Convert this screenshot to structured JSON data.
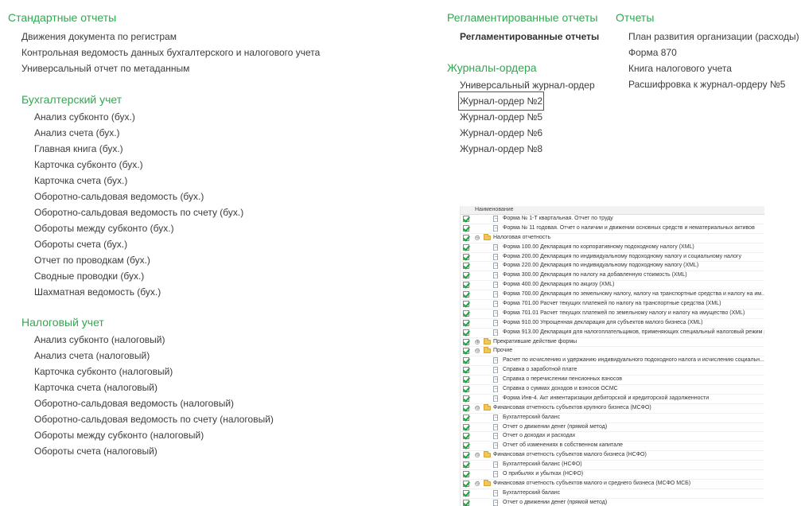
{
  "standard": {
    "title": "Стандартные отчеты",
    "items": [
      "Движения документа по регистрам",
      "Контрольная ведомость данных бухгалтерского и налогового учета",
      "Универсальный отчет по метаданным"
    ]
  },
  "accounting": {
    "title": "Бухгалтерский учет",
    "items": [
      "Анализ субконто (бух.)",
      "Анализ счета (бух.)",
      "Главная книга (бух.)",
      "Карточка субконто (бух.)",
      "Карточка счета (бух.)",
      "Оборотно-сальдовая ведомость (бух.)",
      "Оборотно-сальдовая ведомость по счету (бух.)",
      "Обороты между субконто (бух.)",
      "Обороты счета (бух.)",
      "Отчет по проводкам (бух.)",
      "Сводные проводки (бух.)",
      "Шахматная ведомость (бух.)"
    ]
  },
  "tax": {
    "title": "Налоговый учет",
    "items": [
      "Анализ субконто (налоговый)",
      "Анализ счета (налоговый)",
      "Карточка субконто (налоговый)",
      "Карточка счета (налоговый)",
      "Оборотно-сальдовая ведомость (налоговый)",
      "Оборотно-сальдовая ведомость по счету (налоговый)",
      "Обороты между субконто (налоговый)",
      "Обороты счета (налоговый)"
    ]
  },
  "regulated": {
    "title": "Регламентированные отчеты",
    "items": [
      "Регламентированные отчеты"
    ]
  },
  "journals": {
    "title": "Журналы-ордера",
    "items": [
      "Универсальный журнал-ордер",
      "Журнал-ордер №2",
      "Журнал-ордер №5",
      "Журнал-ордер №6",
      "Журнал-ордер №8"
    ]
  },
  "reports": {
    "title": "Отчеты",
    "items": [
      "План развития организации (расходы)",
      "Форма 870",
      "Книга налогового учета",
      "Расшифровка к журнал-ордеру №5"
    ]
  },
  "tree": {
    "header": "Наименование",
    "rows": [
      {
        "level": 2,
        "kind": "doc",
        "label": "Форма № 1-Т квартальная. Отчет по труду"
      },
      {
        "level": 2,
        "kind": "doc",
        "label": "Форма № 11 годовая. Отчет о наличии и движении основных средств и нематериальных активов"
      },
      {
        "level": 1,
        "kind": "folder",
        "expander": "⊖",
        "label": "Налоговая отчетность"
      },
      {
        "level": 2,
        "kind": "doc",
        "label": "Форма 100.00 Декларация по корпоративному подоходному налогу (XML)"
      },
      {
        "level": 2,
        "kind": "doc",
        "label": "Форма 200.00 Декларация по индивидуальному подоходному налогу и социальному налогу"
      },
      {
        "level": 2,
        "kind": "doc",
        "label": "Форма 220.00 Декларация по индивидуальному подоходному налогу (XML)"
      },
      {
        "level": 2,
        "kind": "doc",
        "label": "Форма 300.00 Декларация по налогу на добавленную стоимость (XML)"
      },
      {
        "level": 2,
        "kind": "doc",
        "label": "Форма 400.00 Декларация по акцизу (XML)"
      },
      {
        "level": 2,
        "kind": "doc",
        "label": "Форма 700.00 Декларация по земельному налогу, налогу на транспортные средства и налогу на им..."
      },
      {
        "level": 2,
        "kind": "doc",
        "label": "Форма 701.00 Расчет текущих платежей по налогу на транспортные средства (XML)"
      },
      {
        "level": 2,
        "kind": "doc",
        "label": "Форма 701.01 Расчет текущих платежей по земельному налогу и налогу на имущество (XML)"
      },
      {
        "level": 2,
        "kind": "doc",
        "label": "Форма 910.00 Упрощенная декларация для субъектов малого бизнеса (XML)"
      },
      {
        "level": 2,
        "kind": "doc",
        "label": "Форма 913.00 Декларация для налогоплательщиков, применяющих специальный налоговый режим р..."
      },
      {
        "level": 1,
        "kind": "folder",
        "expander": "⊕",
        "label": "Прекратившие действие формы"
      },
      {
        "level": 1,
        "kind": "folder",
        "expander": "⊖",
        "label": "Прочие"
      },
      {
        "level": 2,
        "kind": "doc",
        "label": "Расчет по исчислению и удержанию индивидуального подоходного налога и исчислению социальн..."
      },
      {
        "level": 2,
        "kind": "doc",
        "label": "Справка о заработной плате"
      },
      {
        "level": 2,
        "kind": "doc",
        "label": "Справка о перечислении пенсионных взносов"
      },
      {
        "level": 2,
        "kind": "doc",
        "label": "Справка о суммах доходов и взносов ОСМС"
      },
      {
        "level": 2,
        "kind": "doc",
        "label": "Форма Инв-4. Акт инвентаризации дебиторской и кредиторской задолженности"
      },
      {
        "level": 1,
        "kind": "folder",
        "expander": "⊖",
        "label": "Финансовая отчетность субъектов крупного бизнеса (МСФО)"
      },
      {
        "level": 2,
        "kind": "doc",
        "label": "Бухгалтерский баланс"
      },
      {
        "level": 2,
        "kind": "doc",
        "label": "Отчет о движении денег (прямой метод)"
      },
      {
        "level": 2,
        "kind": "doc",
        "label": "Отчет о доходах и расходах"
      },
      {
        "level": 2,
        "kind": "doc",
        "label": "Отчет об изменениях в собственном капитале"
      },
      {
        "level": 1,
        "kind": "folder",
        "expander": "⊖",
        "label": "Финансовая отчетность субъектов малого бизнеса (НСФО)"
      },
      {
        "level": 2,
        "kind": "doc",
        "label": "Бухгалтерский баланс (НСФО)"
      },
      {
        "level": 2,
        "kind": "doc",
        "label": "О прибылях и убытках (НСФО)"
      },
      {
        "level": 1,
        "kind": "folder",
        "expander": "⊖",
        "label": "Финансовая отчетность субъектов малого и среднего бизнеса (МСФО МСБ)"
      },
      {
        "level": 2,
        "kind": "doc",
        "label": "Бухгалтерский баланс"
      },
      {
        "level": 2,
        "kind": "doc",
        "label": "Отчет о движении денег (прямой метод)"
      },
      {
        "level": 2,
        "kind": "doc",
        "label": "Отчет о совокупном доходе"
      },
      {
        "level": 2,
        "kind": "doc",
        "label": "Отчет об изменениях в собственном капитале"
      }
    ]
  },
  "colors": {
    "section_title": "#2fa84f",
    "link": "#3c3c3c",
    "check": "#1aa53a"
  }
}
